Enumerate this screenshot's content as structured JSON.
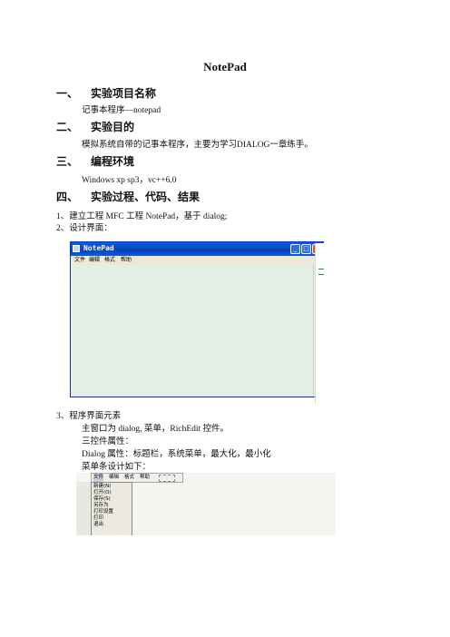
{
  "doc": {
    "title": "NotePad",
    "sections": [
      {
        "num": "一、",
        "heading": "实验项目名称",
        "body": "记事本程序—notepad"
      },
      {
        "num": "二、",
        "heading": "实验目的",
        "body": "模拟系统自带的记事本程序，主要为学习DIALOG一章练手。"
      },
      {
        "num": "三、",
        "heading": "编程环境",
        "body": "Windows xp sp3，vc++6.0"
      },
      {
        "num": "四、",
        "heading": "实验过程、代码、结果"
      }
    ],
    "step1": "1、建立工程 MFC  工程 NotePad，基于 dialog;",
    "step2": "2、设计界面：",
    "step3": "3、程序界面元素",
    "line_main": "主窗口为 dialog, 菜单，RichEdit 控件。",
    "line_props": "三控件属性：",
    "line_dialog": "Dialog 属性：标题栏，系统菜单，最大化，最小化",
    "line_menu": "菜单条设计如下："
  },
  "notepad_window": {
    "title": "NotePad",
    "menu": [
      "文件",
      "编辑",
      "格式",
      "帮助"
    ],
    "min_btn": "_",
    "max_btn": "□",
    "close_btn": "X"
  },
  "menu_design": {
    "bar": [
      "文件",
      "编辑",
      "格式",
      "帮助"
    ],
    "file_items": [
      "新建(N)",
      "打开(O)",
      "保存(S)",
      "另存为",
      "打印设置",
      "打印",
      "退出"
    ]
  }
}
